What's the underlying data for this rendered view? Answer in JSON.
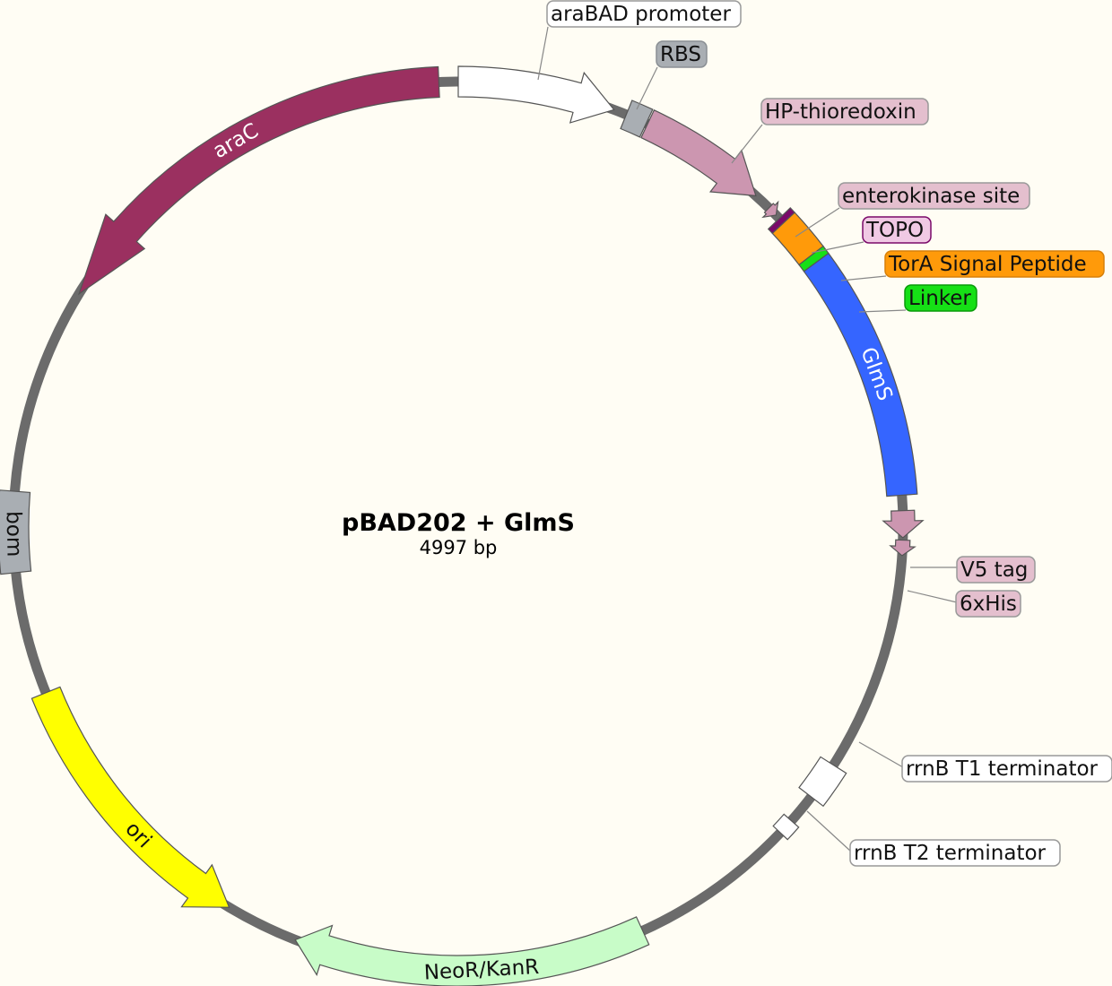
{
  "plasmid": {
    "name": "pBAD202 + GlmS",
    "length_label": "4997 bp",
    "backbone_color": "#6b6b6b"
  },
  "features": [
    {
      "id": "arac",
      "label": "araC",
      "color": "#9b3060",
      "text_color": "#ffffff",
      "type": "arrow",
      "direction": "ccw"
    },
    {
      "id": "arabad",
      "label": "araBAD promoter",
      "color": "#ffffff",
      "type": "arrow",
      "direction": "cw"
    },
    {
      "id": "rbs",
      "label": "RBS",
      "color": "#a9aeb3",
      "type": "box"
    },
    {
      "id": "hp-trx",
      "label": "HP-thioredoxin",
      "color": "#cc96b0",
      "type": "arrow",
      "direction": "cw"
    },
    {
      "id": "ek-site",
      "label": "enterokinase site",
      "color": "#cc96b0",
      "type": "arrow",
      "direction": "cw"
    },
    {
      "id": "topo",
      "label": "TOPO",
      "color": "#7a0a6a",
      "type": "box"
    },
    {
      "id": "tora",
      "label": "TorA Signal Peptide",
      "color": "#ff9a0a",
      "type": "box"
    },
    {
      "id": "linker",
      "label": "Linker",
      "color": "#16e016",
      "type": "box"
    },
    {
      "id": "glms",
      "label": "GlmS",
      "color": "#3565ff",
      "text_color": "#ffffff",
      "type": "box"
    },
    {
      "id": "v5",
      "label": "V5 tag",
      "color": "#cc96b0",
      "type": "arrow",
      "direction": "cw"
    },
    {
      "id": "his",
      "label": "6xHis",
      "color": "#cc96b0",
      "type": "arrow",
      "direction": "cw"
    },
    {
      "id": "rrnbt1",
      "label": "rrnB T1 terminator",
      "color": "#ffffff",
      "type": "box"
    },
    {
      "id": "rrnbt2",
      "label": "rrnB T2 terminator",
      "color": "#ffffff",
      "type": "box"
    },
    {
      "id": "neor",
      "label": "NeoR/KanR",
      "color": "#c8fcc8",
      "text_color": "#111111",
      "type": "arrow",
      "direction": "cw"
    },
    {
      "id": "ori",
      "label": "ori",
      "color": "#ffff00",
      "text_color": "#111111",
      "type": "arrow",
      "direction": "ccw"
    },
    {
      "id": "bom",
      "label": "bom",
      "color": "#a9aeb3",
      "text_color": "#111111",
      "type": "box"
    }
  ]
}
